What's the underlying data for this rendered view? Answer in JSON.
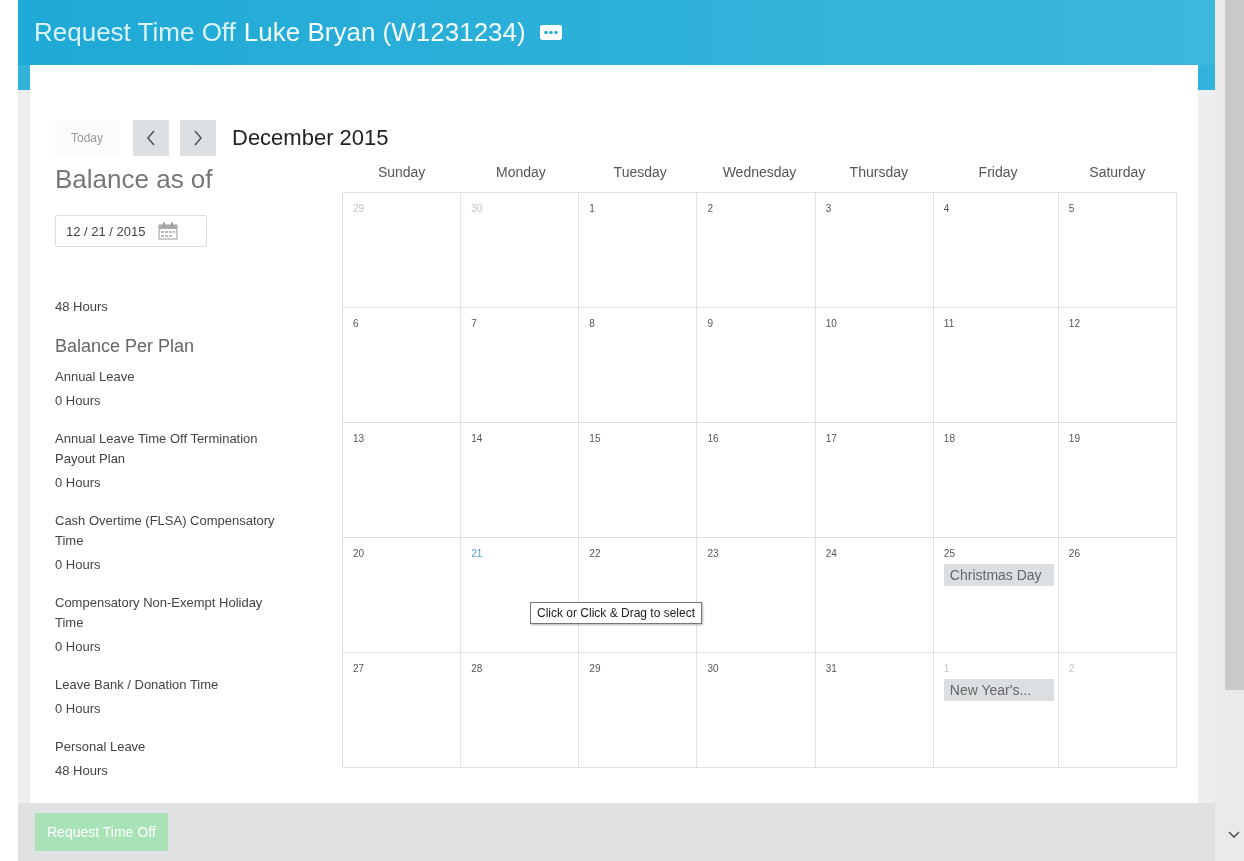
{
  "header": {
    "title": "Request Time Off",
    "worker": "Luke Bryan (W1231234)"
  },
  "toolbar": {
    "today": {
      "label": "Today",
      "disabled": true
    },
    "month": "December 2015"
  },
  "balance": {
    "heading": "Balance as of",
    "date": "12 / 21 / 2015",
    "total": "48 Hours",
    "plan_heading": "Balance Per Plan",
    "plans": [
      {
        "name": "Annual Leave",
        "hours": "0 Hours"
      },
      {
        "name": "Annual Leave Time Off Termination Payout Plan",
        "hours": "0 Hours"
      },
      {
        "name": "Cash Overtime (FLSA) Compensatory Time",
        "hours": "0 Hours"
      },
      {
        "name": "Compensatory Non-Exempt Holiday Time",
        "hours": "0 Hours"
      },
      {
        "name": "Leave Bank / Donation Time",
        "hours": "0 Hours"
      },
      {
        "name": "Personal Leave",
        "hours": "48 Hours"
      }
    ]
  },
  "calendar": {
    "weekdays": [
      "Sunday",
      "Monday",
      "Tuesday",
      "Wednesday",
      "Thursday",
      "Friday",
      "Saturday"
    ],
    "weeks": [
      [
        {
          "day": "29",
          "outside": true,
          "today": false
        },
        {
          "day": "30",
          "outside": true,
          "today": false
        },
        {
          "day": "1",
          "outside": false,
          "today": false
        },
        {
          "day": "2",
          "outside": false,
          "today": false
        },
        {
          "day": "3",
          "outside": false,
          "today": false
        },
        {
          "day": "4",
          "outside": false,
          "today": false
        },
        {
          "day": "5",
          "outside": false,
          "today": false
        }
      ],
      [
        {
          "day": "6",
          "outside": false,
          "today": false
        },
        {
          "day": "7",
          "outside": false,
          "today": false
        },
        {
          "day": "8",
          "outside": false,
          "today": false
        },
        {
          "day": "9",
          "outside": false,
          "today": false
        },
        {
          "day": "10",
          "outside": false,
          "today": false
        },
        {
          "day": "11",
          "outside": false,
          "today": false
        },
        {
          "day": "12",
          "outside": false,
          "today": false
        }
      ],
      [
        {
          "day": "13",
          "outside": false,
          "today": false
        },
        {
          "day": "14",
          "outside": false,
          "today": false
        },
        {
          "day": "15",
          "outside": false,
          "today": false
        },
        {
          "day": "16",
          "outside": false,
          "today": false
        },
        {
          "day": "17",
          "outside": false,
          "today": false
        },
        {
          "day": "18",
          "outside": false,
          "today": false
        },
        {
          "day": "19",
          "outside": false,
          "today": false
        }
      ],
      [
        {
          "day": "20",
          "outside": false,
          "today": false
        },
        {
          "day": "21",
          "outside": false,
          "today": true
        },
        {
          "day": "22",
          "outside": false,
          "today": false
        },
        {
          "day": "23",
          "outside": false,
          "today": false
        },
        {
          "day": "24",
          "outside": false,
          "today": false
        },
        {
          "day": "25",
          "outside": false,
          "today": false,
          "events": [
            "Christmas Day"
          ]
        },
        {
          "day": "26",
          "outside": false,
          "today": false
        }
      ],
      [
        {
          "day": "27",
          "outside": false,
          "today": false
        },
        {
          "day": "28",
          "outside": false,
          "today": false
        },
        {
          "day": "29",
          "outside": false,
          "today": false
        },
        {
          "day": "30",
          "outside": false,
          "today": false
        },
        {
          "day": "31",
          "outside": false,
          "today": false
        },
        {
          "day": "1",
          "outside": true,
          "today": false,
          "events": [
            "New Year's..."
          ]
        },
        {
          "day": "2",
          "outside": true,
          "today": false
        }
      ]
    ],
    "tooltip": "Click or Click & Drag to select"
  },
  "footer": {
    "button": {
      "label": "Request Time Off",
      "disabled": true
    }
  }
}
